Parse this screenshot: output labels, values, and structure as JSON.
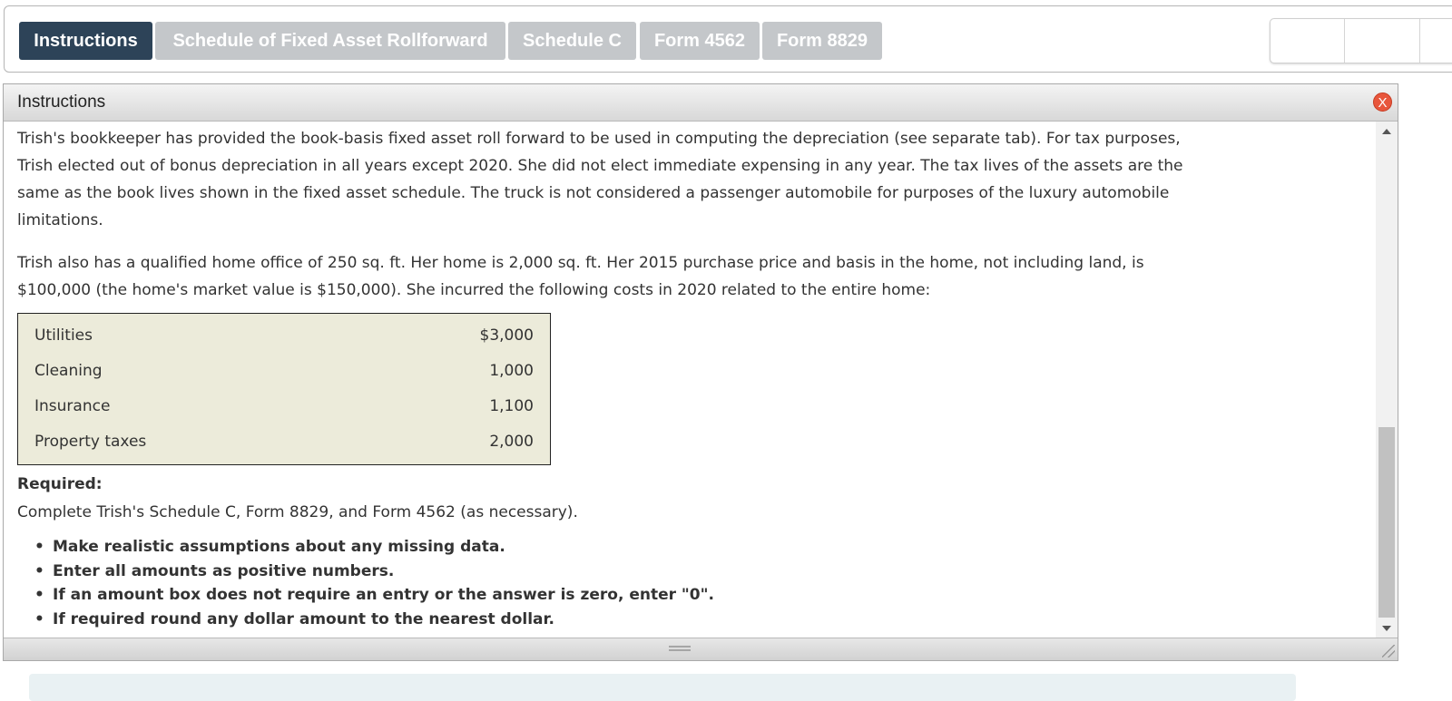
{
  "tabs": [
    {
      "label": "Instructions",
      "active": true
    },
    {
      "label": "Schedule of Fixed Asset Rollforward",
      "active": false
    },
    {
      "label": "Schedule C",
      "active": false
    },
    {
      "label": "Form 4562",
      "active": false
    },
    {
      "label": "Form 8829",
      "active": false
    }
  ],
  "dialog": {
    "title": "Instructions",
    "close_label": "X",
    "paragraphs": [
      "Trish's bookkeeper has provided the book-basis fixed asset roll forward to be used in computing the depreciation (see separate tab). For tax purposes, Trish elected out of bonus depreciation in all years except 2020. She did not elect immediate expensing in any year. The tax lives of the assets are the same as the book lives shown in the fixed asset schedule. The truck is not considered a passenger automobile for purposes of the luxury automobile limitations.",
      "Trish also has a qualified home office of 250 sq. ft. Her home is 2,000 sq. ft. Her 2015 purchase price and basis in the home, not including land, is $100,000 (the home's market value is $150,000). She incurred the following costs in 2020 related to the entire home:"
    ],
    "costs": [
      {
        "label": "Utilities",
        "value": "$3,000"
      },
      {
        "label": "Cleaning",
        "value": "1,000"
      },
      {
        "label": "Insurance",
        "value": "1,100"
      },
      {
        "label": "Property taxes",
        "value": "2,000"
      }
    ],
    "required_title": "Required:",
    "required_text": "Complete Trish's Schedule C, Form 8829, and Form 4562 (as necessary).",
    "bullets": [
      "Make realistic assumptions about any missing data.",
      "Enter all amounts as positive numbers.",
      "If an amount box does not require an entry or the answer is zero, enter \"0\".",
      "If required round any dollar amount to the nearest dollar."
    ]
  },
  "colors": {
    "active_tab": "#2d4358",
    "inactive_tab": "#c4c7ca",
    "table_bg": "#ecebda",
    "close_button": "#e8563c"
  }
}
